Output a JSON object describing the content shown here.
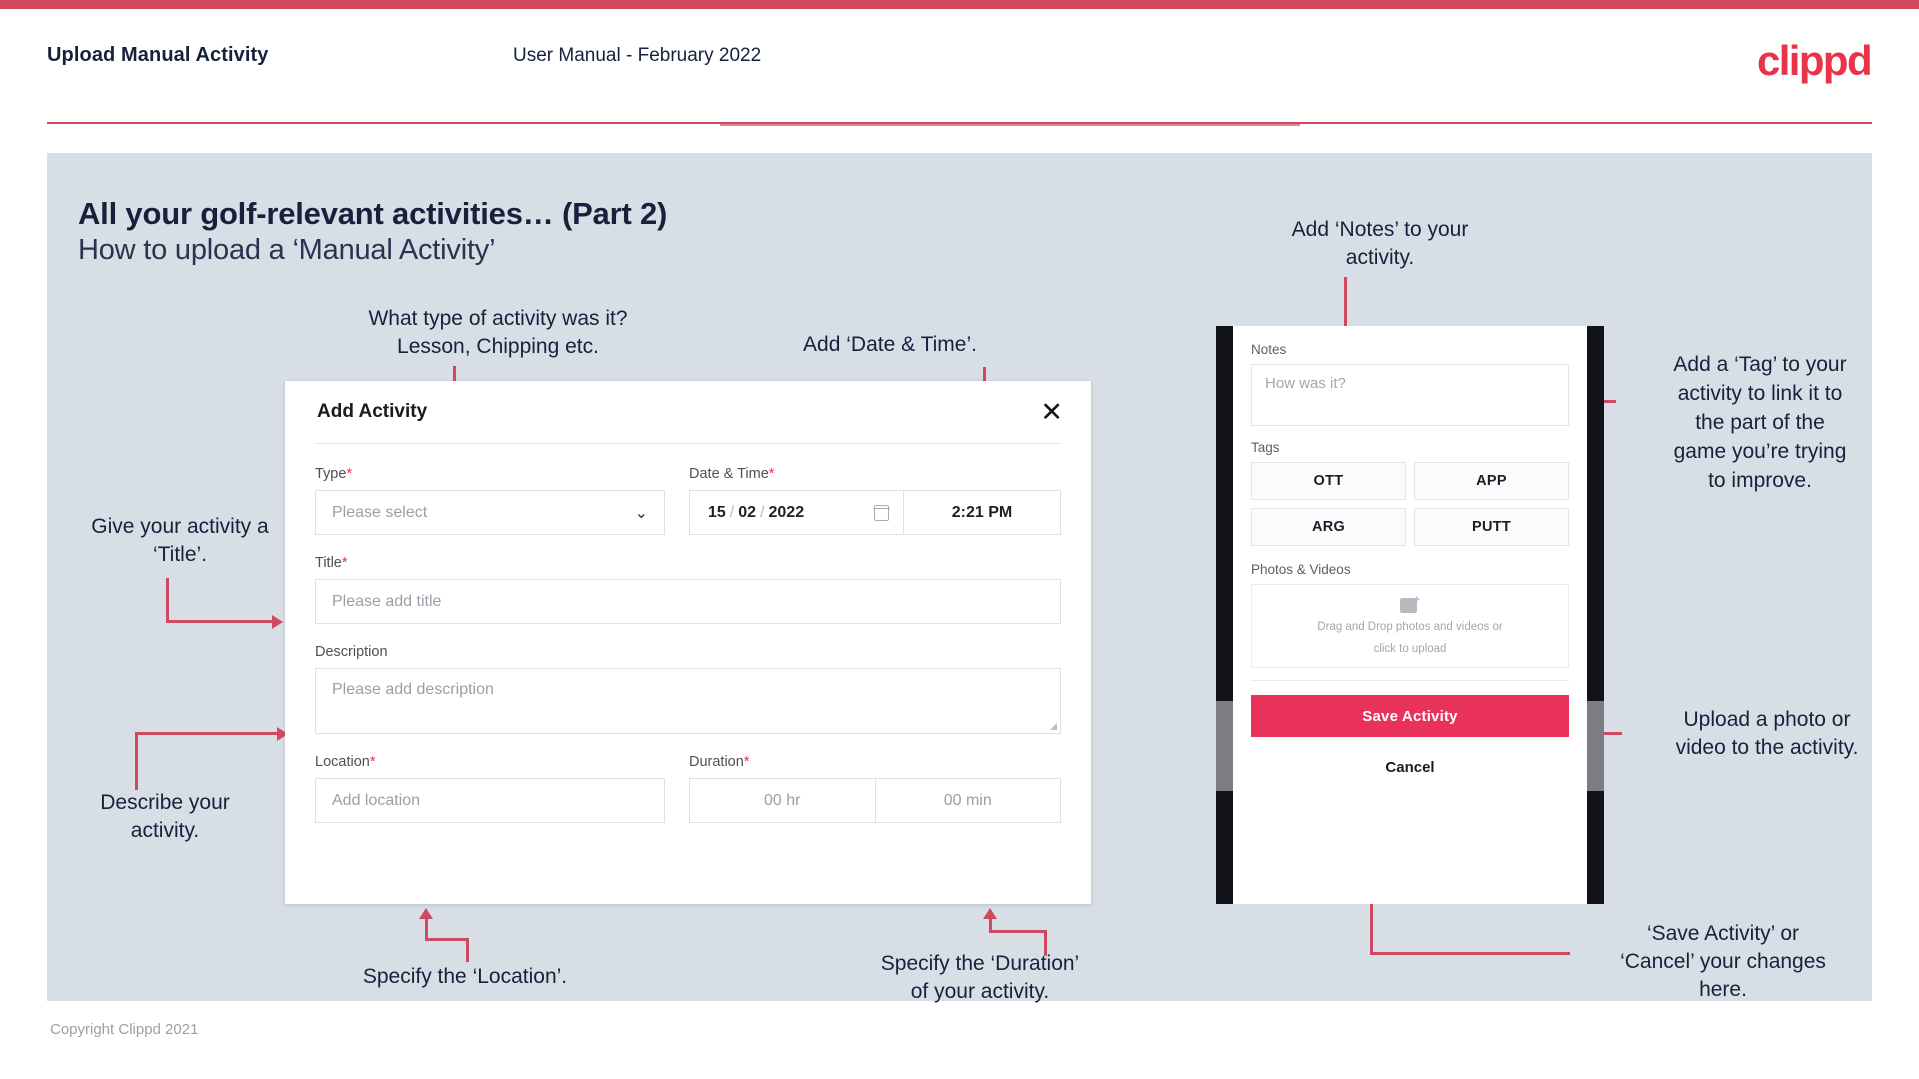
{
  "header": {
    "title": "Upload Manual Activity",
    "subtitle": "User Manual - February 2022",
    "logo": "clippd"
  },
  "slide": {
    "title": "All your golf-relevant activities… (Part 2)",
    "subtitle": "How to upload a ‘Manual Activity’"
  },
  "modal": {
    "title": "Add Activity",
    "close_icon": "✕",
    "fields": {
      "type": {
        "label": "Type",
        "required": "*",
        "placeholder": "Please select",
        "chevron": "⌄"
      },
      "datetime": {
        "label": "Date & Time",
        "required": "*",
        "day": "15",
        "month": "02",
        "year": "2022",
        "separator": "/",
        "time": "2:21 PM"
      },
      "title": {
        "label": "Title",
        "required": "*",
        "placeholder": "Please add title"
      },
      "description": {
        "label": "Description",
        "placeholder": "Please add description"
      },
      "location": {
        "label": "Location",
        "required": "*",
        "placeholder": "Add location"
      },
      "duration": {
        "label": "Duration",
        "required": "*",
        "hours": "00 hr",
        "minutes": "00 min"
      }
    }
  },
  "phone": {
    "notes": {
      "label": "Notes",
      "placeholder": "How was it?"
    },
    "tags": {
      "label": "Tags",
      "items": [
        "OTT",
        "APP",
        "ARG",
        "PUTT"
      ]
    },
    "photos": {
      "label": "Photos & Videos",
      "drop_line1": "Drag and Drop photos and videos or",
      "drop_line2": "click to upload",
      "plus": "+"
    },
    "save_label": "Save Activity",
    "cancel_label": "Cancel"
  },
  "annotations": {
    "type": "What type of activity was it?\nLesson, Chipping etc.",
    "datetime": "Add ‘Date & Time’.",
    "title": "Give your activity a\n‘Title’.",
    "description": "Describe your\nactivity.",
    "location": "Specify the ‘Location’.",
    "duration": "Specify the ‘Duration’\nof your activity.",
    "notes": "Add ‘Notes’ to your\nactivity.",
    "tags": "Add a ‘Tag’ to your\nactivity to link it to\nthe part of the\ngame you’re trying\nto improve.",
    "upload": "Upload a photo or\nvideo to the activity.",
    "save": "‘Save Activity’ or\n‘Cancel’ your changes\nhere."
  },
  "footer": {
    "copyright": "Copyright Clippd 2021"
  },
  "colors": {
    "accent": "#cf4a60",
    "brand": "#e8334a",
    "slide_bg": "#d8dee6",
    "text": "#17213c"
  }
}
